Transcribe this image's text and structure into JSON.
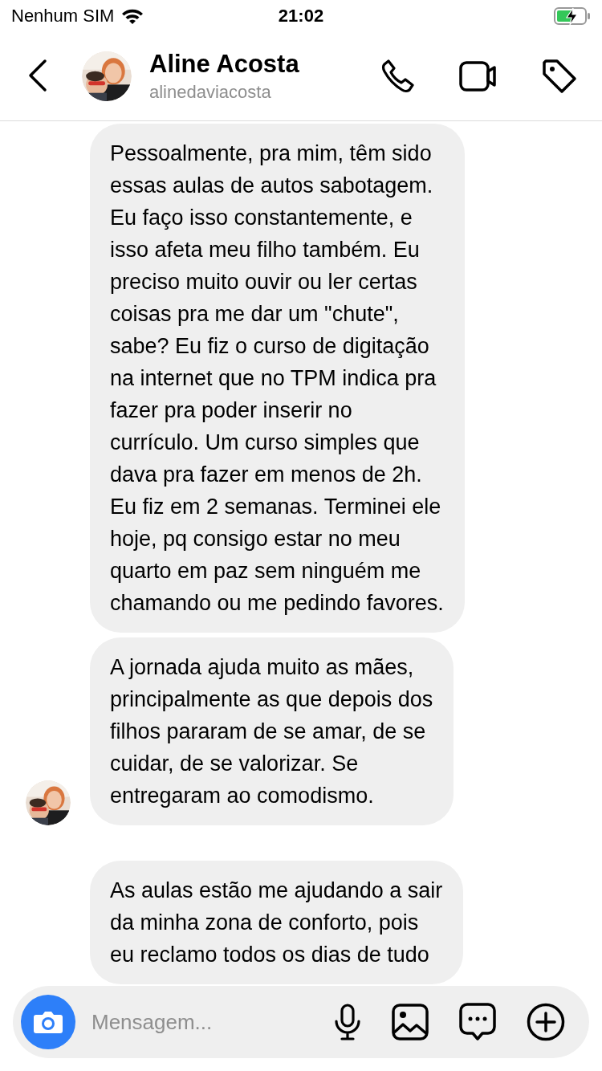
{
  "status_bar": {
    "carrier": "Nenhum SIM",
    "time": "21:02"
  },
  "header": {
    "name": "Aline Acosta",
    "username": "alinedaviacosta"
  },
  "messages": [
    {
      "avatar": false,
      "lines": [
        "Pessoalmente, pra mim, têm sido",
        "essas aulas de autos sabotagem.",
        "Eu faço isso constantemente, e",
        "isso afeta meu filho também. Eu",
        "preciso muito ouvir ou ler certas",
        "coisas pra me dar um \"chute\",",
        "sabe? Eu fiz o curso de digitação",
        "na internet que no TPM indica pra",
        "fazer pra poder inserir no",
        "currículo. Um curso simples que",
        "dava pra fazer em menos de 2h.",
        "Eu fiz em 2 semanas. Terminei ele",
        "hoje, pq consigo estar no meu",
        "quarto em paz sem ninguém me",
        "chamando ou me pedindo favores."
      ]
    },
    {
      "avatar": true,
      "lines": [
        "A jornada ajuda muito as mães,",
        "principalmente as que depois dos",
        "filhos pararam de se amar, de se",
        "cuidar, de se valorizar. Se",
        "entregaram ao comodismo."
      ]
    },
    {
      "avatar": false,
      "lines": [
        "As aulas estão me ajudando a sair",
        "da minha zona de conforto, pois",
        "eu reclamo todos os dias de tudo"
      ]
    }
  ],
  "composer": {
    "placeholder": "Mensagem..."
  }
}
